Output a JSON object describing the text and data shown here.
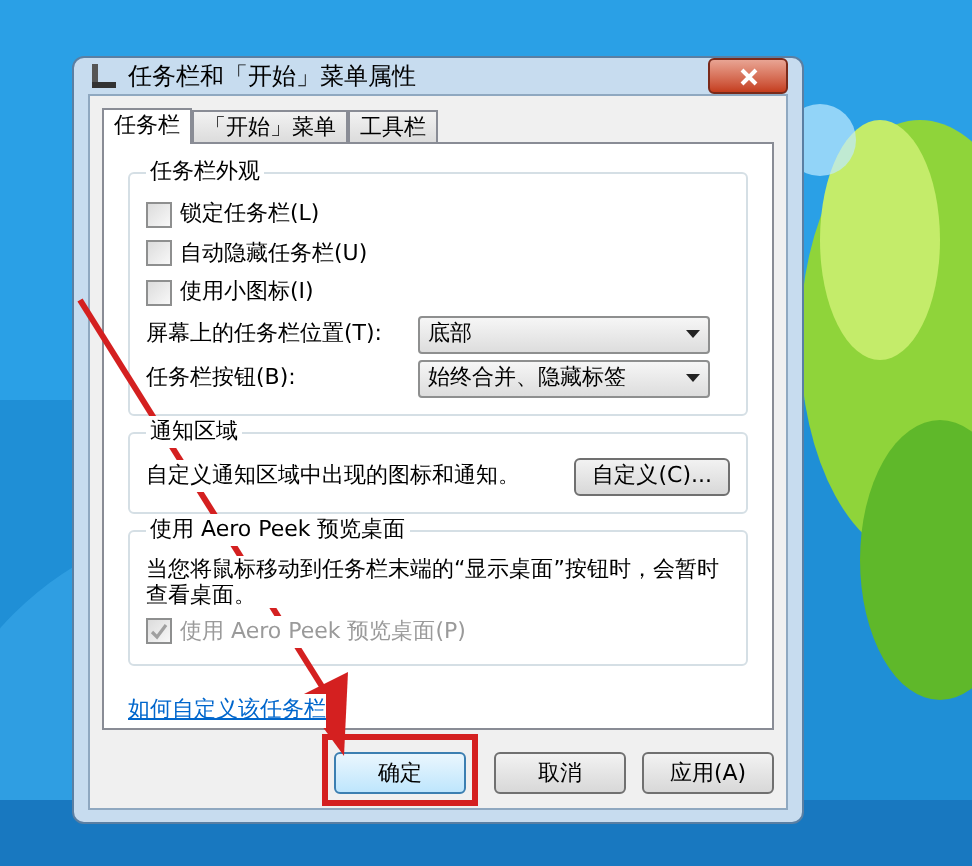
{
  "window": {
    "title": "任务栏和「开始」菜单属性"
  },
  "tabs": [
    {
      "label": "任务栏",
      "selected": true
    },
    {
      "label": "「开始」菜单",
      "selected": false
    },
    {
      "label": "工具栏",
      "selected": false
    }
  ],
  "appearance": {
    "title": "任务栏外观",
    "checkboxes": [
      {
        "label": "锁定任务栏(L)",
        "checked": false
      },
      {
        "label": "自动隐藏任务栏(U)",
        "checked": false
      },
      {
        "label": "使用小图标(I)",
        "checked": false
      }
    ],
    "dropdowns": [
      {
        "label": "屏幕上的任务栏位置(T):",
        "value": "底部"
      },
      {
        "label": "任务栏按钮(B):",
        "value": "始终合并、隐藏标签"
      }
    ]
  },
  "notification": {
    "title": "通知区域",
    "text": "自定义通知区域中出现的图标和通知。",
    "button": "自定义(C)..."
  },
  "aero_peek": {
    "title": "使用 Aero Peek 预览桌面",
    "text": "当您将鼠标移动到任务栏末端的“显示桌面”按钮时，会暂时查看桌面。",
    "checkbox": {
      "label": "使用 Aero Peek 预览桌面(P)",
      "checked": true,
      "disabled": true
    }
  },
  "link": "如何自定义该任务栏",
  "buttons": [
    {
      "label": "确定",
      "annotated": true
    },
    {
      "label": "取消",
      "annotated": false
    },
    {
      "label": "应用(A)",
      "annotated": false
    }
  ]
}
